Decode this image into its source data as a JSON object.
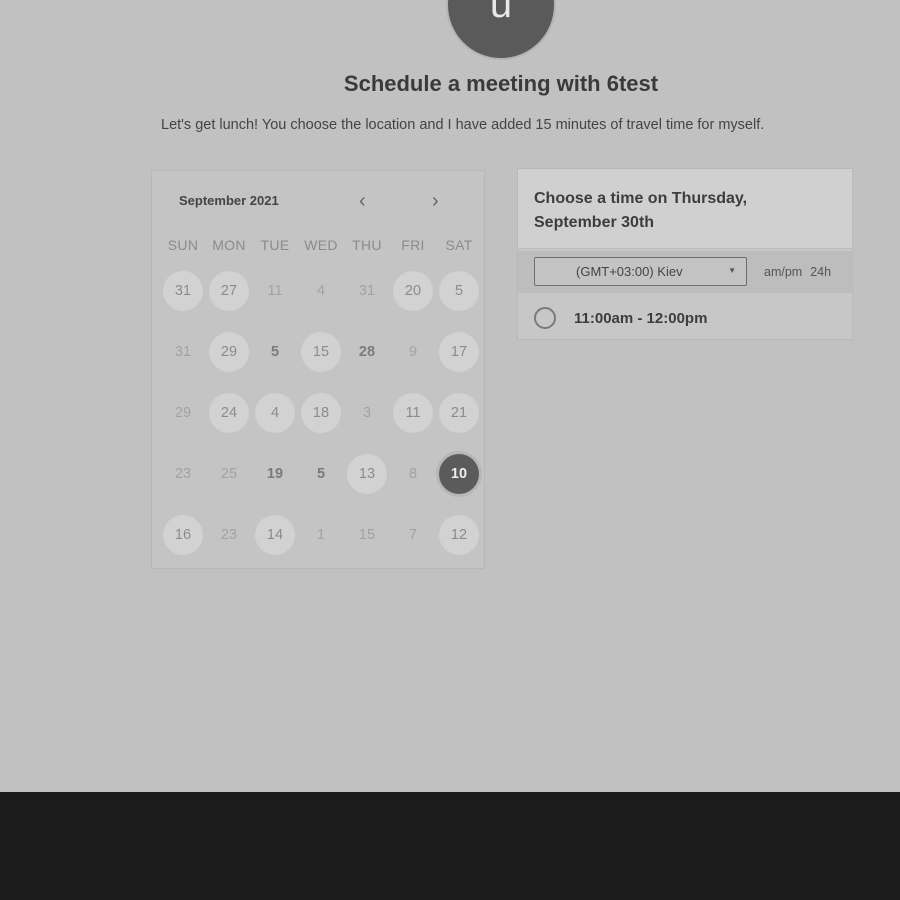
{
  "avatar": {
    "initial": "u"
  },
  "header": {
    "title": "Schedule a meeting with 6test",
    "description": "Let's get lunch! You choose the location and I have added 15 minutes of travel time for myself."
  },
  "calendar": {
    "month": "September 2021",
    "prev_icon": "chevron-left-icon",
    "next_icon": "chevron-right-icon",
    "weekdays": [
      "SUN",
      "MON",
      "TUE",
      "WED",
      "THU",
      "FRI",
      "SAT"
    ],
    "weeks": [
      [
        {
          "label": "31",
          "available": true
        },
        {
          "label": "27",
          "available": true
        },
        {
          "label": "11",
          "available": false
        },
        {
          "label": "4",
          "available": false
        },
        {
          "label": "31",
          "available": false
        },
        {
          "label": "20",
          "available": true
        },
        {
          "label": "5",
          "available": true
        }
      ],
      [
        {
          "label": "31",
          "available": false
        },
        {
          "label": "29",
          "available": true
        },
        {
          "label": "5",
          "available": false,
          "bold": true
        },
        {
          "label": "15",
          "available": true
        },
        {
          "label": "28",
          "available": false,
          "bold": true
        },
        {
          "label": "9",
          "available": false
        },
        {
          "label": "17",
          "available": true
        }
      ],
      [
        {
          "label": "29",
          "available": false
        },
        {
          "label": "24",
          "available": true
        },
        {
          "label": "4",
          "available": true
        },
        {
          "label": "18",
          "available": true
        },
        {
          "label": "3",
          "available": false
        },
        {
          "label": "11",
          "available": true
        },
        {
          "label": "21",
          "available": true
        }
      ],
      [
        {
          "label": "23",
          "available": false
        },
        {
          "label": "25",
          "available": false
        },
        {
          "label": "19",
          "available": false,
          "bold": true
        },
        {
          "label": "5",
          "available": false,
          "bold": true
        },
        {
          "label": "13",
          "available": true
        },
        {
          "label": "8",
          "available": false
        },
        {
          "label": "10",
          "available": true,
          "selected": true
        }
      ],
      [
        {
          "label": "16",
          "available": true
        },
        {
          "label": "23",
          "available": false
        },
        {
          "label": "14",
          "available": true
        },
        {
          "label": "1",
          "available": false
        },
        {
          "label": "15",
          "available": false
        },
        {
          "label": "7",
          "available": false
        },
        {
          "label": "12",
          "available": true
        }
      ]
    ]
  },
  "time_panel": {
    "title": "Choose a time on Thursday, September 30th",
    "timezone": "(GMT+03:00) Kiev",
    "format_ampm": "am/pm",
    "format_24h": "24h",
    "slots": [
      {
        "label": "11:00am - 12:00pm"
      }
    ]
  },
  "colors": {
    "background": "#c1c1c1",
    "selected_day": "#5b5b5b",
    "available_day": "#d2d2d2",
    "footer": "#1b1b1b"
  }
}
